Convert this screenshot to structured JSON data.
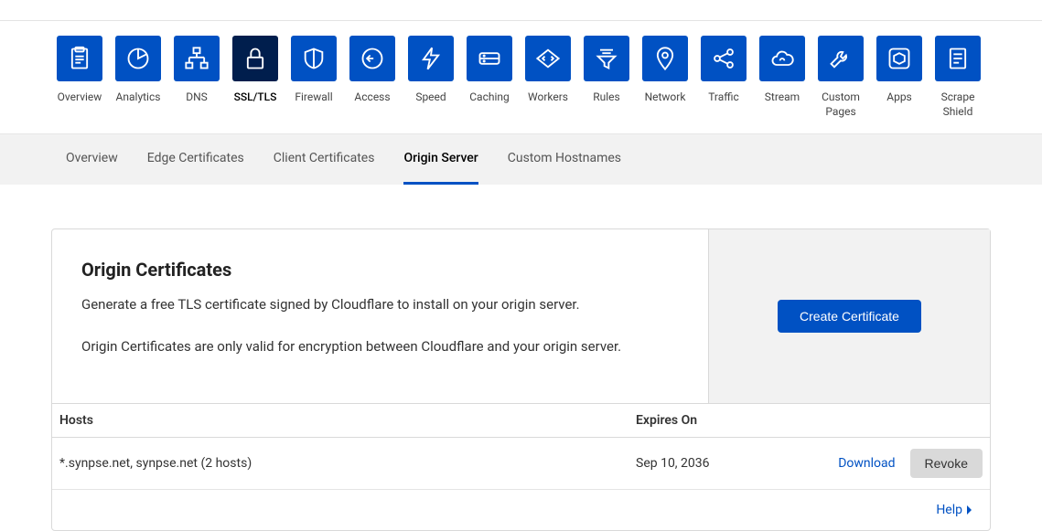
{
  "nav": [
    {
      "label": "Overview",
      "icon": "clipboard"
    },
    {
      "label": "Analytics",
      "icon": "pie"
    },
    {
      "label": "DNS",
      "icon": "sitemap"
    },
    {
      "label": "SSL/TLS",
      "icon": "lock",
      "active": true
    },
    {
      "label": "Firewall",
      "icon": "shield"
    },
    {
      "label": "Access",
      "icon": "portal"
    },
    {
      "label": "Speed",
      "icon": "bolt"
    },
    {
      "label": "Caching",
      "icon": "drive"
    },
    {
      "label": "Workers",
      "icon": "code"
    },
    {
      "label": "Rules",
      "icon": "funnel"
    },
    {
      "label": "Network",
      "icon": "pin"
    },
    {
      "label": "Traffic",
      "icon": "share"
    },
    {
      "label": "Stream",
      "icon": "cloud"
    },
    {
      "label": "Custom\nPages",
      "icon": "wrench"
    },
    {
      "label": "Apps",
      "icon": "hex"
    },
    {
      "label": "Scrape\nShield",
      "icon": "doc"
    }
  ],
  "subtabs": [
    {
      "label": "Overview"
    },
    {
      "label": "Edge Certificates"
    },
    {
      "label": "Client Certificates"
    },
    {
      "label": "Origin Server",
      "active": true
    },
    {
      "label": "Custom Hostnames"
    }
  ],
  "card": {
    "title": "Origin Certificates",
    "desc1": "Generate a free TLS certificate signed by Cloudflare to install on your origin server.",
    "desc2": "Origin Certificates are only valid for encryption between Cloudflare and your origin server.",
    "create_label": "Create Certificate"
  },
  "table": {
    "headers": {
      "hosts": "Hosts",
      "expires": "Expires On"
    },
    "rows": [
      {
        "hosts": "*.synpse.net, synpse.net (2 hosts)",
        "expires": "Sep 10, 2036",
        "download": "Download",
        "revoke": "Revoke"
      }
    ]
  },
  "help_label": "Help"
}
